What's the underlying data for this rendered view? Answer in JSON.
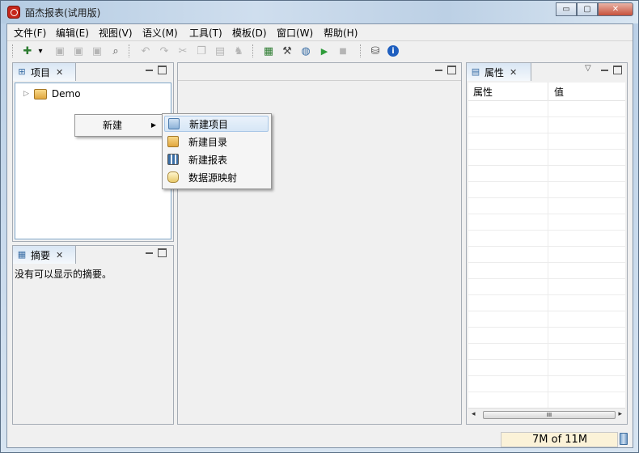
{
  "window": {
    "title": "皕杰报表(试用版)",
    "buttons": {
      "minimize": "▭",
      "maximize": "▢",
      "close": "✕"
    }
  },
  "menubar": {
    "items": [
      "文件(F)",
      "编辑(E)",
      "视图(V)",
      "语义(M)",
      "工具(T)",
      "模板(D)",
      "窗口(W)",
      "帮助(H)"
    ]
  },
  "toolbar": {
    "buttons": [
      {
        "icon": "new-icon",
        "glyph": "✚",
        "enabled": true
      },
      {
        "icon": "dropdown-arrow-icon",
        "glyph": "▾",
        "enabled": true
      },
      {
        "icon": "save-icon",
        "glyph": "▣",
        "enabled": false
      },
      {
        "icon": "save-as-icon",
        "glyph": "▣",
        "enabled": false
      },
      {
        "icon": "save-all-icon",
        "glyph": "▣",
        "enabled": false
      },
      {
        "icon": "zoom-icon",
        "glyph": "⌕",
        "enabled": true
      },
      {
        "icon": "undo-icon",
        "glyph": "↶",
        "enabled": false
      },
      {
        "icon": "redo-icon",
        "glyph": "↷",
        "enabled": false
      },
      {
        "icon": "cut-icon",
        "glyph": "✂",
        "enabled": false
      },
      {
        "icon": "copy-icon",
        "glyph": "❐",
        "enabled": false
      },
      {
        "icon": "paste-icon",
        "glyph": "▤",
        "enabled": false
      },
      {
        "icon": "find-icon",
        "glyph": "♞",
        "enabled": false
      },
      {
        "icon": "excel-icon",
        "glyph": "▦",
        "enabled": true
      },
      {
        "icon": "tools-icon",
        "glyph": "⚒",
        "enabled": true
      },
      {
        "icon": "globe-icon",
        "glyph": "◍",
        "enabled": true
      },
      {
        "icon": "run-icon",
        "glyph": "▶",
        "enabled": true
      },
      {
        "icon": "stop-icon",
        "glyph": "■",
        "enabled": false
      },
      {
        "icon": "datasource-icon",
        "glyph": "⛁",
        "enabled": true
      },
      {
        "icon": "info-icon",
        "glyph": "i",
        "enabled": true
      }
    ]
  },
  "project_panel": {
    "tab_label": "项目",
    "tree": [
      {
        "label": "Demo",
        "expanded": false
      }
    ]
  },
  "summary_panel": {
    "tab_label": "摘要",
    "message": "没有可以显示的摘要。"
  },
  "properties_panel": {
    "tab_label": "属性",
    "columns": [
      "属性",
      "值"
    ],
    "scrollbar_thumb": "III"
  },
  "context_menu": {
    "item": "新建",
    "submenu_arrow": "▶",
    "submenu": [
      "新建项目",
      "新建目录",
      "新建报表",
      "数据源映射"
    ],
    "highlighted_index": 0
  },
  "status": {
    "heap": "7M of 11M"
  },
  "colors": {
    "accent": "#3a6ea5",
    "run_green": "#2e9c3a",
    "info_blue": "#1f5fbf"
  }
}
